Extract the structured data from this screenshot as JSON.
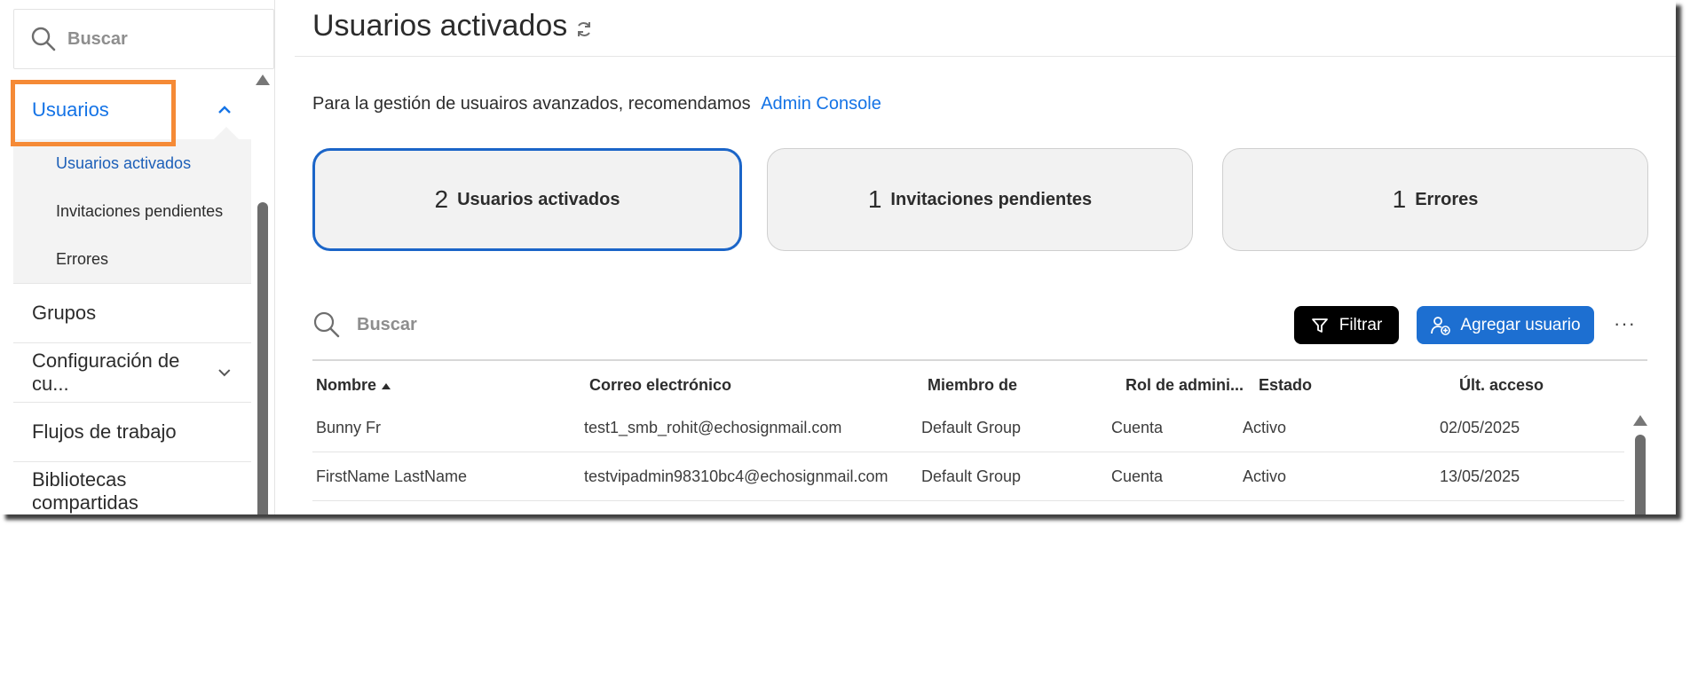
{
  "sidebar": {
    "search_placeholder": "Buscar",
    "users_label": "Usuarios",
    "sub_items": [
      "Usuarios activados",
      "Invitaciones pendientes",
      "Errores"
    ],
    "groups_label": "Grupos",
    "account_settings_label": "Configuración de cu...",
    "workflows_label": "Flujos de trabajo",
    "shared_libraries_label": "Bibliotecas compartidas"
  },
  "header": {
    "title": "Usuarios activados"
  },
  "info": {
    "text": "Para la gestión de usuairos avanzados, recomendamos",
    "link": "Admin Console"
  },
  "cards": [
    {
      "count": "2",
      "label": "Usuarios activados"
    },
    {
      "count": "1",
      "label": "Invitaciones pendientes"
    },
    {
      "count": "1",
      "label": "Errores"
    }
  ],
  "toolbar": {
    "search_placeholder": "Buscar",
    "filter_label": "Filtrar",
    "add_user_label": "Agregar usuario",
    "more_label": "···"
  },
  "table": {
    "columns": [
      "Nombre",
      "Correo electrónico",
      "Miembro de",
      "Rol de admini...",
      "Estado",
      "Últ. acceso"
    ],
    "rows": [
      [
        "Bunny Fr",
        "test1_smb_rohit@echosignmail.com",
        "Default Group",
        "Cuenta",
        "Activo",
        "02/05/2025"
      ],
      [
        "FirstName LastName",
        "testvipadmin98310bc4@echosignmail.com",
        "Default Group",
        "Cuenta",
        "Activo",
        "13/05/2025"
      ]
    ]
  },
  "colors": {
    "accent_blue": "#1473e6",
    "highlight_orange": "#f58a36",
    "button_blue": "#1d6fd1",
    "card_bg": "#f2f2f2"
  }
}
